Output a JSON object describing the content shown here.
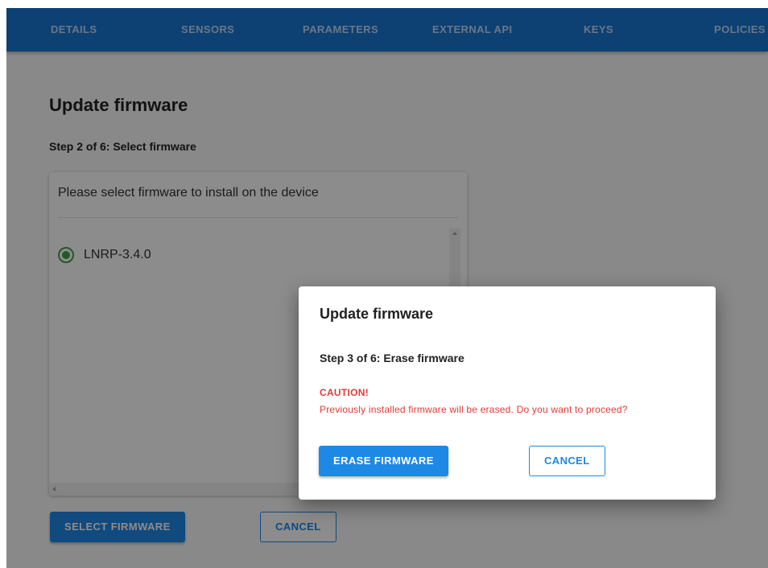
{
  "topnav": {
    "tabs": [
      {
        "label": "DETAILS"
      },
      {
        "label": "SENSORS"
      },
      {
        "label": "PARAMETERS"
      },
      {
        "label": "EXTERNAL API"
      },
      {
        "label": "KEYS"
      },
      {
        "label": "POLICIES"
      }
    ]
  },
  "page": {
    "title": "Update firmware",
    "step": "Step 2 of 6: Select firmware"
  },
  "firmware_card": {
    "header": "Please select firmware to install on the device",
    "options": [
      {
        "label": "LNRP-3.4.0",
        "selected": true
      }
    ]
  },
  "page_actions": {
    "select_label": "SELECT FIRMWARE",
    "cancel_label": "CANCEL"
  },
  "dialog": {
    "title": "Update firmware",
    "step": "Step 3 of 6: Erase firmware",
    "caution": "CAUTION!",
    "message": "Previously installed firmware will be erased. Do you want to proceed?",
    "erase_label": "ERASE FIRMWARE",
    "cancel_label": "CANCEL"
  },
  "colors": {
    "nav": "#1976d2",
    "primary": "#1e88e5",
    "radio": "#43a047",
    "warning": "#e53935"
  }
}
